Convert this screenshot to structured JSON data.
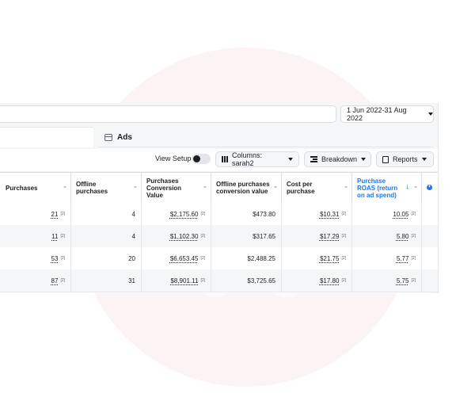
{
  "date_range": "1 Jun 2022-31 Aug 2022",
  "ads_tab": "Ads",
  "toolbar": {
    "view_setup": "View Setup",
    "columns": "Columns: sarah2",
    "breakdown": "Breakdown",
    "reports": "Reports"
  },
  "headers": {
    "purchases": "Purchases",
    "offline_purchases": "Offline purchases",
    "conv_value": "Purchases Conversion Value",
    "offline_conv_value": "Offline purchases conversion value",
    "cost_per_purchase": "Cost per purchase",
    "roas": "Purchase ROAS (return on ad spend)"
  },
  "footnote_marker": "[2]",
  "rows": [
    {
      "purchases": "21",
      "offline": "4",
      "conv_value": "$2,175.60",
      "offline_value": "$473.80",
      "cpp": "$10.31",
      "roas": "10.05"
    },
    {
      "purchases": "11",
      "offline": "4",
      "conv_value": "$1,102.30",
      "offline_value": "$317.65",
      "cpp": "$17.29",
      "roas": "5.80"
    },
    {
      "purchases": "53",
      "offline": "20",
      "conv_value": "$6,653.45",
      "offline_value": "$2,488.25",
      "cpp": "$21.75",
      "roas": "5.77"
    },
    {
      "purchases": "87",
      "offline": "31",
      "conv_value": "$8,901.11",
      "offline_value": "$3,725.65",
      "cpp": "$17.80",
      "roas": "5.75"
    }
  ],
  "colors": {
    "accent": "#1877f2",
    "watermark": "#fcf3f4",
    "panel": "#f5f6f7"
  }
}
